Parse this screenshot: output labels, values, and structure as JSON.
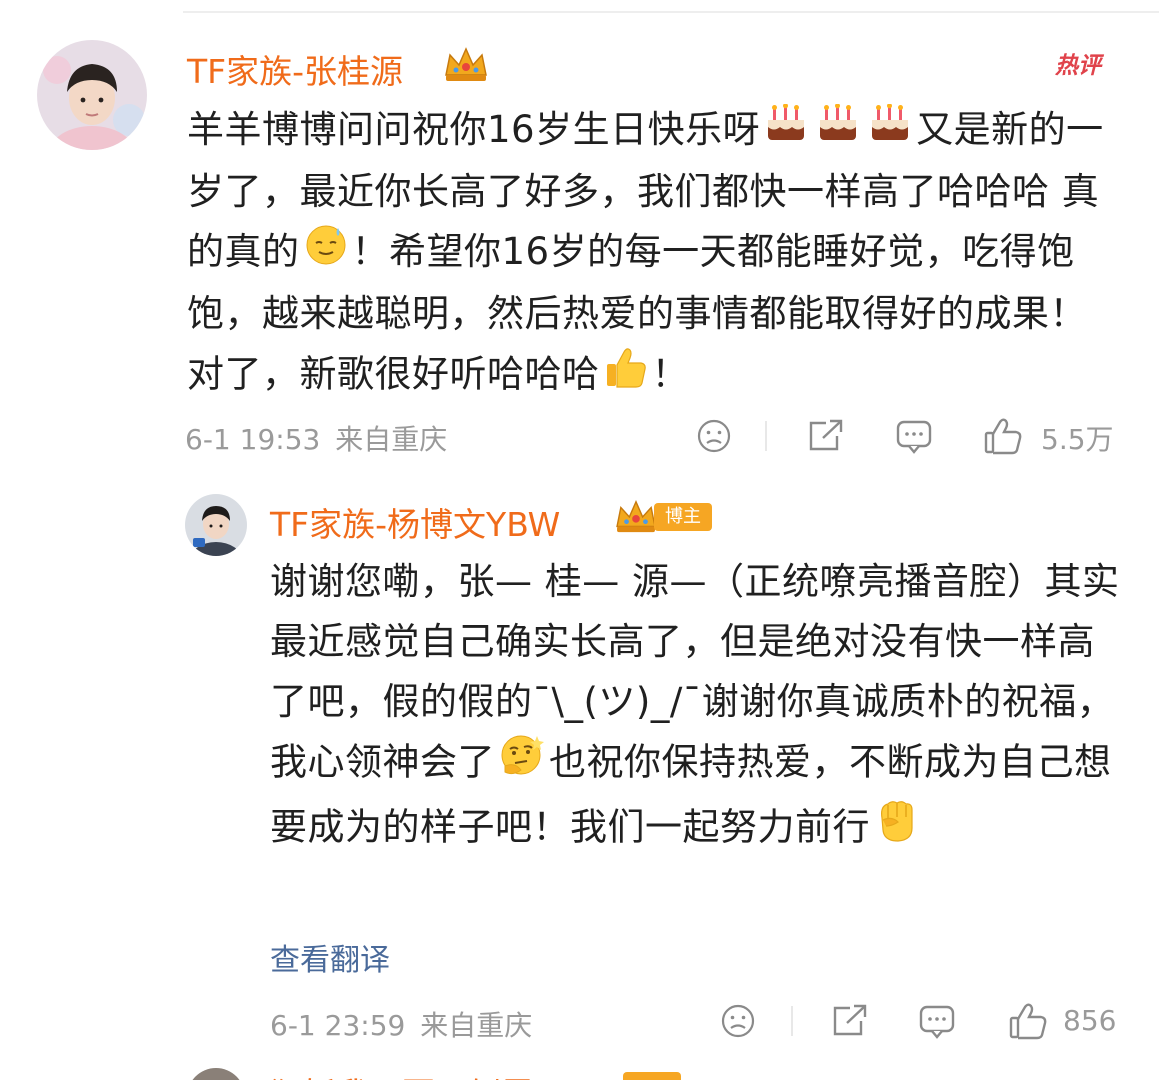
{
  "comment1": {
    "username": "TF家族-张桂源",
    "hot_label": "热评",
    "text_parts": [
      "羊羊博博问问祝你16岁生日快乐呀",
      "又是新的一岁了，最近你长高了好多，我们都快一样高了哈哈哈 真的真的",
      "！希望你16岁的每一天都能睡好觉，吃得饱饱，越来越聪明，然后热爱的事情都能取得好的成果！对了，新歌很好听哈哈哈",
      "！"
    ],
    "emojis": [
      "cake-emoji",
      "cake-emoji",
      "cake-emoji",
      "sweat-smile-emoji",
      "thumbs-up-emoji"
    ],
    "timestamp": "6-1 19:53",
    "location": "来自重庆",
    "like_count": "5.5万"
  },
  "reply": {
    "username": "TF家族-杨博文YBW",
    "author_badge": "博主",
    "text_parts": [
      "谢谢您嘞，张— 桂— 源—（正统嘹亮播音腔）其实最近感觉自己确实长高了，但是绝对没有快一样高了吧，假的假的¯\\_(ツ)_/¯谢谢你真诚质朴的祝福，我心领神会了",
      "也祝你保持热爱，不断成为自己想要成为的样子吧！我们一起努力前行"
    ],
    "emojis": [
      "thinking-face-emoji",
      "raised-fist-emoji"
    ],
    "translate_label": "查看翻译",
    "timestamp": "6-1 23:59",
    "location": "来自重庆",
    "like_count": "856"
  },
  "next_comment": {
    "username_partial": "狂妖我不要不倒霉了"
  },
  "colors": {
    "username": "#f06b1a",
    "hot": "#e0434b",
    "badge": "#f6a623",
    "meta": "#9a9a9a",
    "link": "#4a6a9a"
  }
}
